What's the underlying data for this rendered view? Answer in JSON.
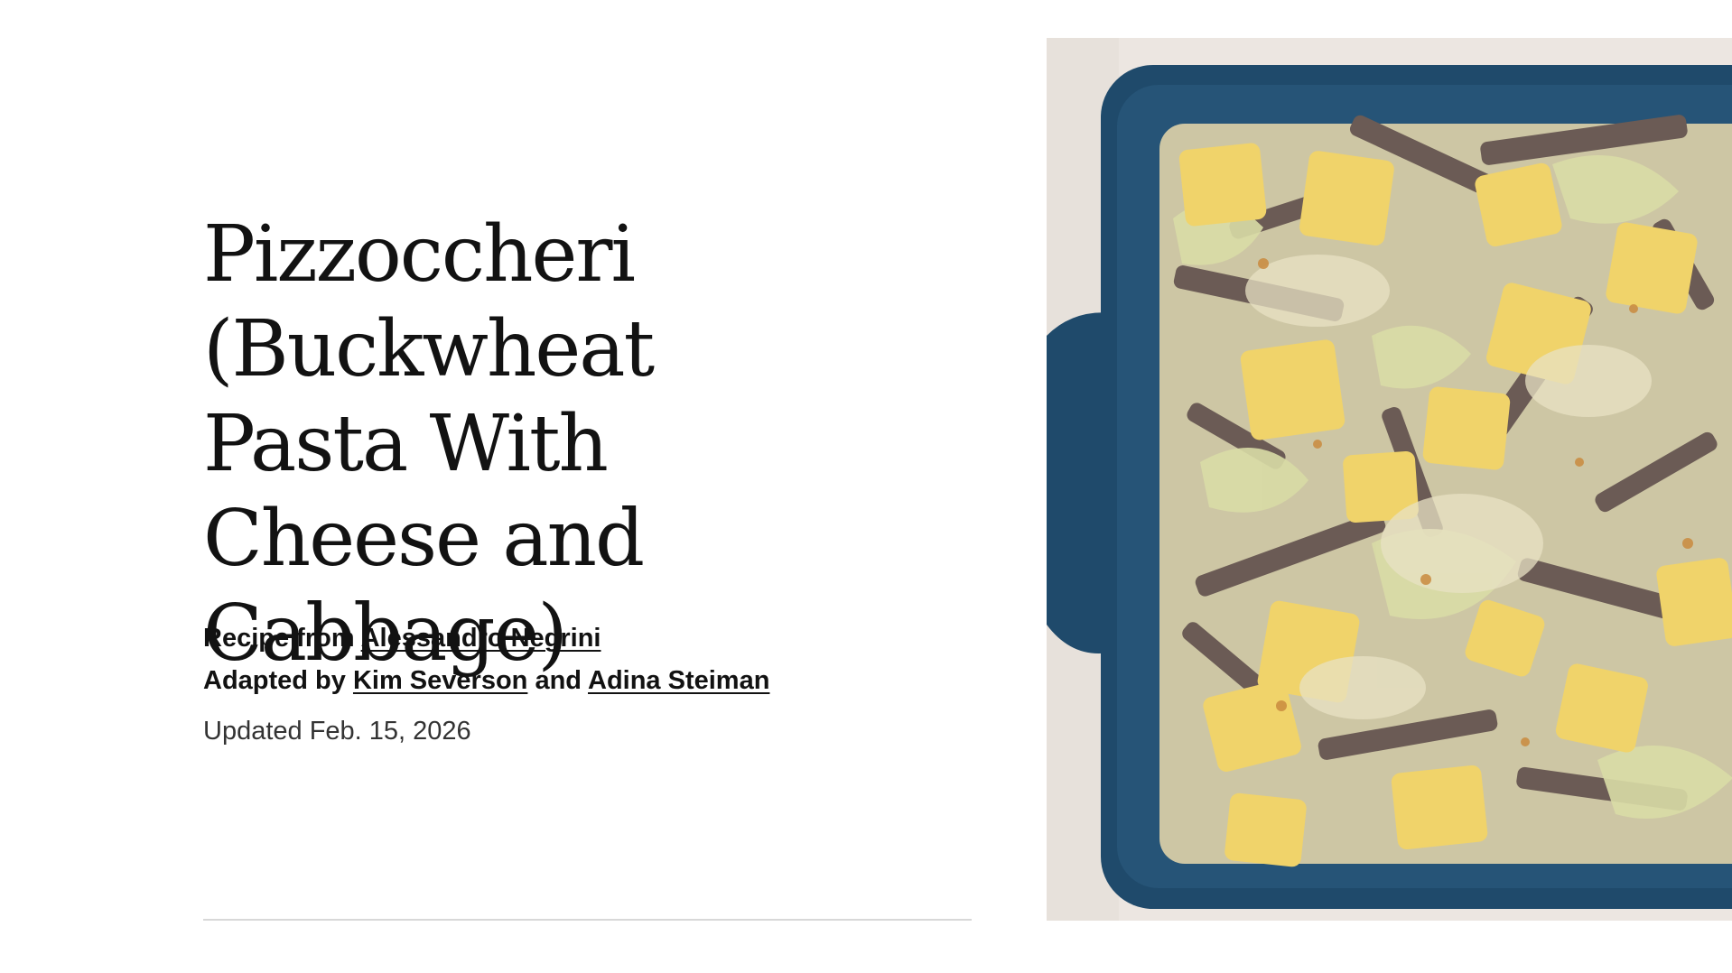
{
  "recipe": {
    "title": "Pizzoccheri (Buckwheat Pasta With Cheese and Cabbage)",
    "byline": {
      "recipe_from_prefix": "Recipe from",
      "recipe_from_author": "Alessandro Negrini",
      "adapted_prefix": "Adapted by",
      "adapter_1": "Kim Severson",
      "conjunction": "and",
      "adapter_2": "Adina Steiman"
    },
    "updated": "Updated Feb. 15, 2026"
  },
  "photo": {
    "subject": "pizzoccheri-baking-dish-photo",
    "colors": {
      "backdrop": "#ece6e1",
      "dish": "#1f4a6b",
      "dish_rim": "#2b5c82",
      "potato": "#f0d36a",
      "cabbage": "#d9dca6",
      "buckwheat": "#6b5b55",
      "sauce": "#e8e2c4"
    }
  }
}
